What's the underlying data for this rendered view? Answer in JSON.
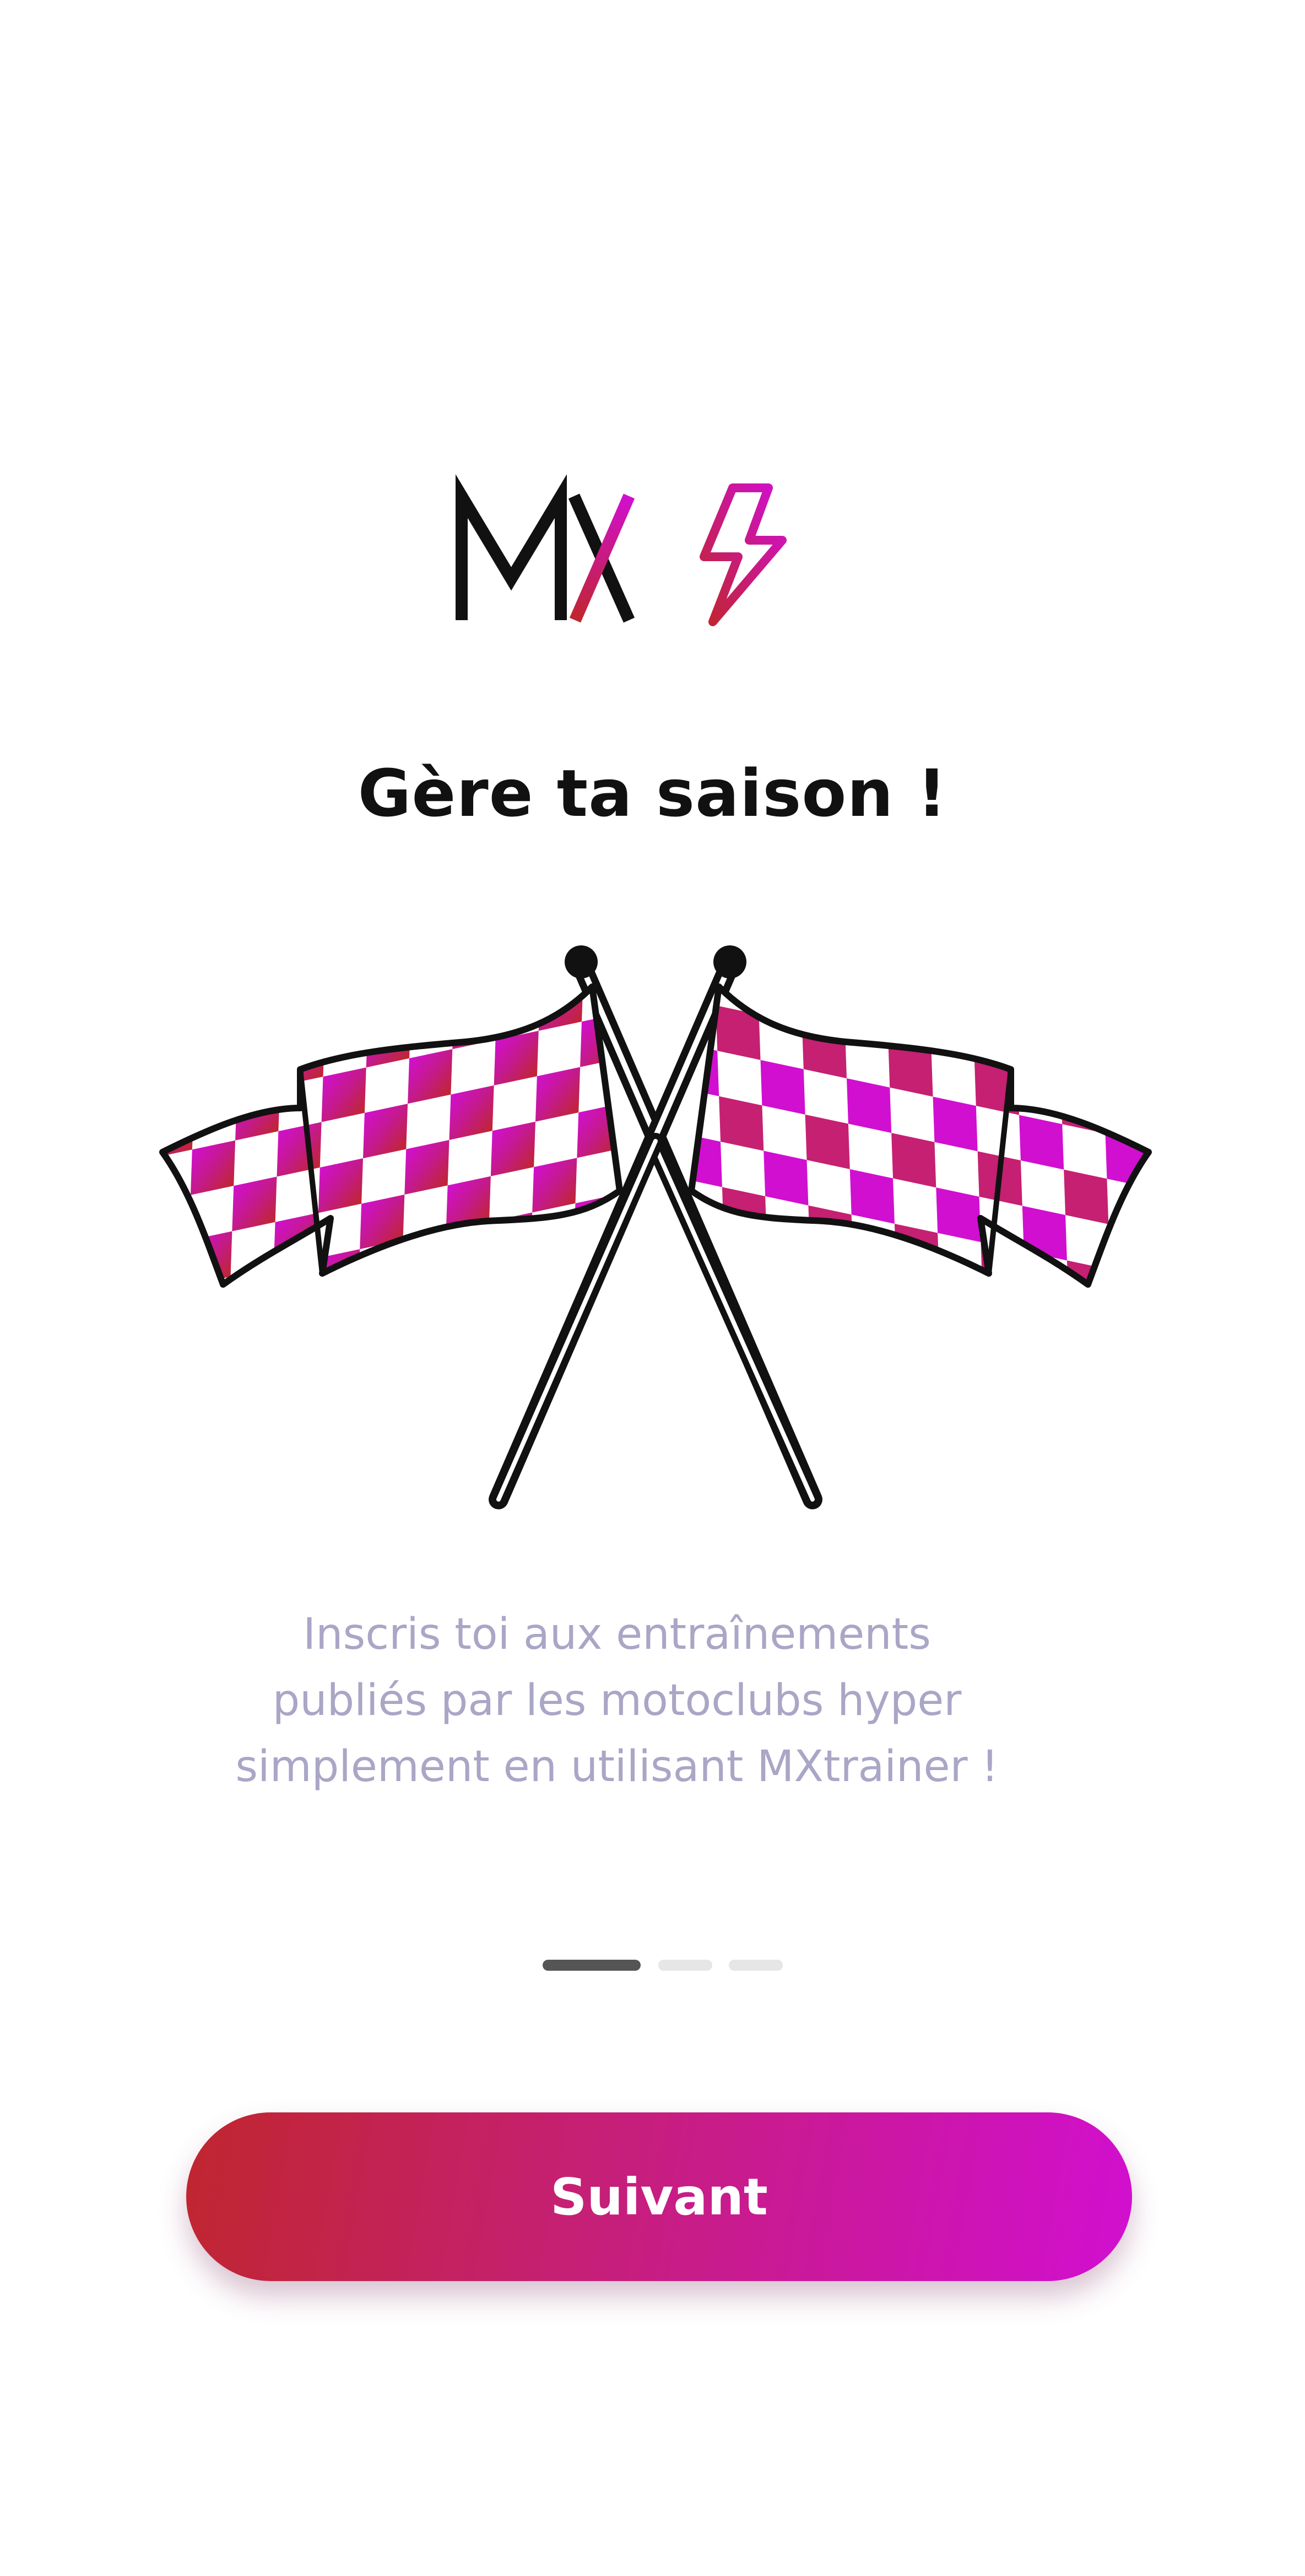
{
  "brand": {
    "logo_text": "MX",
    "logo_icon": "lightning-bolt-icon",
    "colors": {
      "text": "#111111",
      "magenta": "#d10fd0",
      "red": "#c0262e"
    }
  },
  "onboarding": {
    "title": "Gère ta saison !",
    "illustration": "crossed-checkered-flags-icon",
    "description": "Inscris toi aux entraînements\npubliés par les motoclubs hyper\nsimplement en utilisant MXtrainer !",
    "pager": {
      "total_pages": 3,
      "current_page": 1
    },
    "next_label": "Suivant"
  },
  "colors": {
    "background": "#ffffff",
    "description_text": "#a9a6c6",
    "pager_active": "#555555",
    "pager_inactive": "#e6e6e6",
    "button_gradient": [
      "#c0262e",
      "#c52072",
      "#d10fd0"
    ]
  }
}
